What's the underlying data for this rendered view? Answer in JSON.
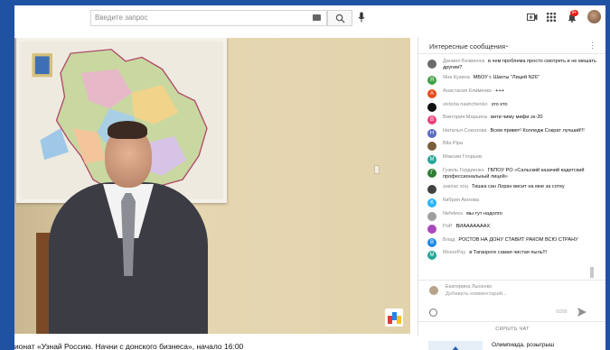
{
  "search": {
    "placeholder": "Введите запрос"
  },
  "notifications": {
    "badge": "9+"
  },
  "video": {
    "title": "ионат «Узнай Россию. Начни с донского бизнеса», начало 16:00"
  },
  "chat": {
    "title": "Интересные сообщения",
    "messages": [
      {
        "author": "Даниил Безвенюк",
        "text": "в чем проблема просто смотреть и не мешать другим?",
        "color": "#6b6b6b",
        "initial": ""
      },
      {
        "author": "Яна Кузина",
        "text": "МБОУ г. Шахты \"Лицей N26\"",
        "color": "#43a047",
        "initial": "Я"
      },
      {
        "author": "Анастасия Клименко",
        "text": "+++",
        "color": "#e64a19",
        "initial": "А"
      },
      {
        "author": "victoria nashchenko",
        "text": "это кто",
        "color": "#111111",
        "initial": ""
      },
      {
        "author": "Виктория Марьина",
        "text": "вити чиму мифи эх-20",
        "color": "#ec407a",
        "initial": "В"
      },
      {
        "author": "Наталья Соколова",
        "text": "Всем привет! Колледж Сократ лучший!!!",
        "color": "#5c6bc0",
        "initial": "Н"
      },
      {
        "author": "Вila Pipa",
        "text": "",
        "color": "#7b5e3a",
        "initial": ""
      },
      {
        "author": "Максим Глорьев",
        "text": "",
        "color": "#26a69a",
        "initial": "М"
      },
      {
        "author": "Гузель Гордиенко",
        "text": "ГБПОУ РО «Сальский казачий кадетский профессиональный лицей»",
        "color": "#2e7d32",
        "initial": "Г"
      },
      {
        "author": "заклас хоц",
        "text": "Тишка сан Лоран висит на мне за сотку",
        "color": "#424242",
        "initial": ""
      },
      {
        "author": "Кибрия Аюхова",
        "text": "",
        "color": "#29b6f6",
        "initial": "К"
      },
      {
        "author": "Nefelees",
        "text": "мы тут надолго",
        "color": "#9e9e9e",
        "initial": ""
      },
      {
        "author": "PoP",
        "text": "ВИАААААААХ",
        "color": "#ab47bc",
        "initial": ""
      },
      {
        "author": "Влад",
        "text": "РОСТОВ НА ДОНУ СТАВИТ РАКОМ ВСЮ СТРАНУ",
        "color": "#1e88e5",
        "initial": "В"
      },
      {
        "author": "MosorPay",
        "text": "в Таганроге самая чистая пыль!!!",
        "color": "#26a69a",
        "initial": "М"
      }
    ],
    "input": {
      "user_name": "Екатерина Лысенко",
      "placeholder": "Добавить комментарий...",
      "counter": "0/200"
    },
    "hide_label": "СКРЫТЬ ЧАТ"
  },
  "recommendation": {
    "title": "Олимпиада, розыгрыш"
  }
}
